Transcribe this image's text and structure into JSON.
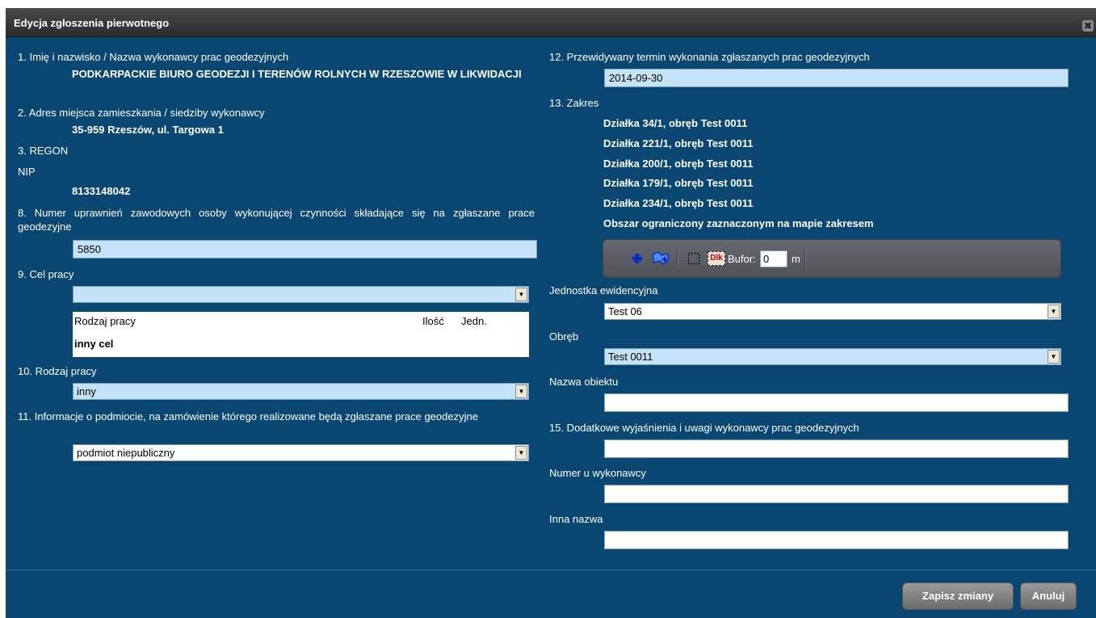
{
  "dialog": {
    "title": "Edycja zgłoszenia pierwotnego",
    "close_glyph": "✖"
  },
  "left": {
    "f1_label": "1. Imię i nazwisko / Nazwa wykonawcy prac geodezyjnych",
    "f1_value": "PODKARPACKIE BIURO GEODEZJI I TERENÓW ROLNYCH W RZESZOWIE W LIKWIDACJI",
    "f2_label": "2. Adres miejsca zamieszkania / siedziby wykonawcy",
    "f2_value": "35-959 Rzeszów, ul. Targowa 1",
    "f3_label": "3. REGON",
    "nip_label": "NIP",
    "nip_value": "8133148042",
    "f8_label": "8. Numer uprawnień zawodowych osoby wykonującej czynności składające się na zgłaszane prace geodezyjne",
    "f8_value": "5850",
    "f9_label": "9. Cel pracy",
    "f9_selected": "",
    "table": {
      "col_type": "Rodzaj pracy",
      "col_qty": "Ilość",
      "col_unit": "Jedn.",
      "row_value": "inny cel"
    },
    "f10_label": "10. Rodzaj pracy",
    "f10_selected": "inny",
    "f11_label": "11. Informacje o podmiocie, na zamówienie którego realizowane będą zgłaszane prace geodezyjne",
    "f11_selected": "podmiot niepubliczny"
  },
  "right": {
    "f12_label": "12. Przewidywany termin wykonania zgłaszanych prac geodezyjnych",
    "f12_value": "2014-09-30",
    "f13_label": "13. Zakres",
    "scope_items": [
      "Działka 34/1, obręb Test 0011",
      "Działka 221/1, obręb Test 0011",
      "Działka 200/1, obręb Test 0011",
      "Działka 179/1, obręb Test 0011",
      "Działka 234/1, obręb Test 0011",
      "Obszar ograniczony zaznaczonym na mapie zakresem"
    ],
    "toolbar": {
      "dlk_label": "Dlk",
      "buffer_label": "Bufor:",
      "buffer_value": "0",
      "unit": "m"
    },
    "unit_label": "Jednostka ewidencyjna",
    "unit_selected": "Test 06",
    "precinct_label": "Obręb",
    "precinct_selected": "Test 0011",
    "object_label": "Nazwa obiektu",
    "object_value": "",
    "f15_label": "15. Dodatkowe wyjaśnienia i uwagi wykonawcy prac geodezyjnych",
    "f15_value": "",
    "contractor_no_label": "Numer u wykonawcy",
    "contractor_no_value": "",
    "other_name_label": "Inna nazwa",
    "other_name_value": ""
  },
  "buttons": {
    "save": "Zapisz zmiany",
    "cancel": "Anuluj"
  },
  "colors": {
    "dialog_bg": "#0a4672",
    "field_highlight": "#c5e3f8",
    "titlebar": "#3a3a3a",
    "button": "#808080"
  },
  "icons": [
    "close-icon",
    "add-point-icon",
    "select-parcels-icon",
    "rectangle-select-icon",
    "dlk-icon",
    "dropdown-arrow-icon"
  ]
}
